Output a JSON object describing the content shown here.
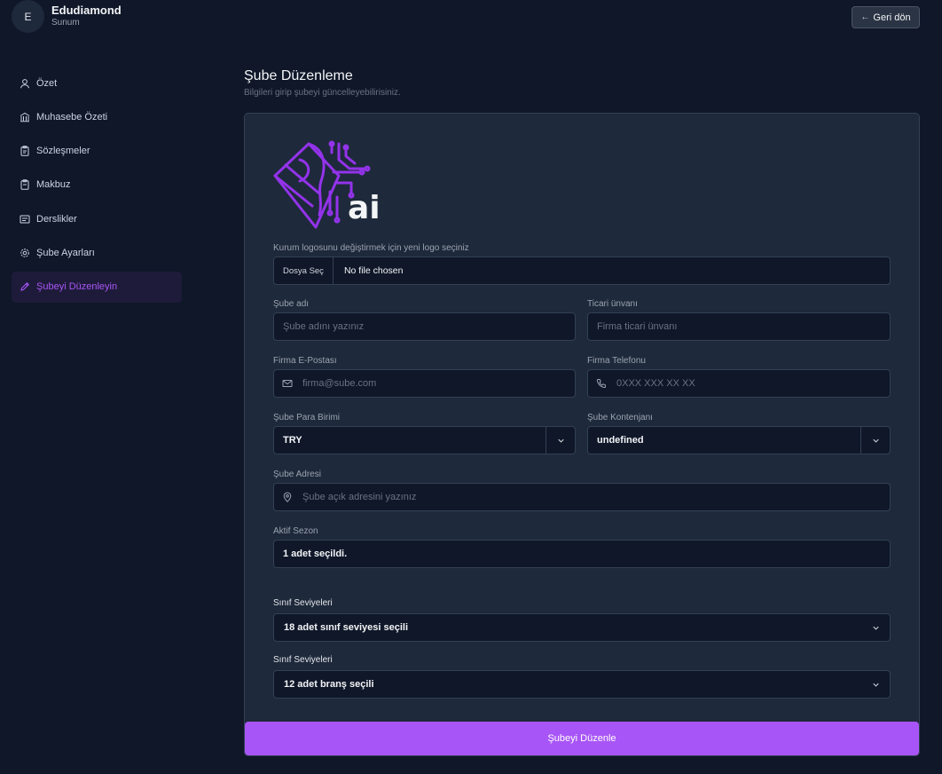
{
  "header": {
    "avatar_letter": "E",
    "brand_name": "Edudiamond",
    "brand_sub": "Sunum",
    "back_label": "Geri dön"
  },
  "sidebar": {
    "items": [
      {
        "label": "Özet",
        "icon": "user-icon"
      },
      {
        "label": "Muhasebe Özeti",
        "icon": "bank-icon"
      },
      {
        "label": "Sözleşmeler",
        "icon": "clipboard-icon"
      },
      {
        "label": "Makbuz",
        "icon": "clipboard-icon"
      },
      {
        "label": "Derslikler",
        "icon": "classroom-icon"
      },
      {
        "label": "Şube Ayarları",
        "icon": "gear-icon"
      },
      {
        "label": "Şubeyi Düzenleyin",
        "icon": "pencil-icon",
        "active": true
      }
    ]
  },
  "main": {
    "title": "Şube Düzenleme",
    "subtitle": "Bilgileri girip şubeyi güncelleyebilirisiniz."
  },
  "form": {
    "logo_text": "ai",
    "logo_label": "Kurum logosunu değiştirmek için yeni logo seçiniz",
    "file_button": "Dosya Seç",
    "file_name": "No file chosen",
    "branch_name_label": "Şube adı",
    "branch_name_placeholder": "Şube adını yazınız",
    "trade_title_label": "Ticari ünvanı",
    "trade_title_placeholder": "Firma ticari ünvanı",
    "email_label": "Firma E-Postası",
    "email_placeholder": "firma@sube.com",
    "phone_label": "Firma Telefonu",
    "phone_placeholder": "0XXX XXX XX XX",
    "currency_label": "Şube Para Birimi",
    "currency_value": "TRY",
    "quota_label": "Şube Kontenjanı",
    "quota_value": "undefined",
    "address_label": "Şube Adresi",
    "address_placeholder": "Şube açık adresini yazınız",
    "season_label": "Aktif Sezon",
    "season_value": "1 adet seçildi.",
    "levels_label": "Sınıf Seviyeleri",
    "levels_value": "18 adet sınıf seviyesi seçili",
    "branches_label": "Sınıf Seviyeleri",
    "branches_value": "12 adet branş seçili",
    "submit_label": "Şubeyi Düzenle"
  },
  "colors": {
    "accent": "#a855f7",
    "background": "#0f1729",
    "card": "#1e293b"
  }
}
